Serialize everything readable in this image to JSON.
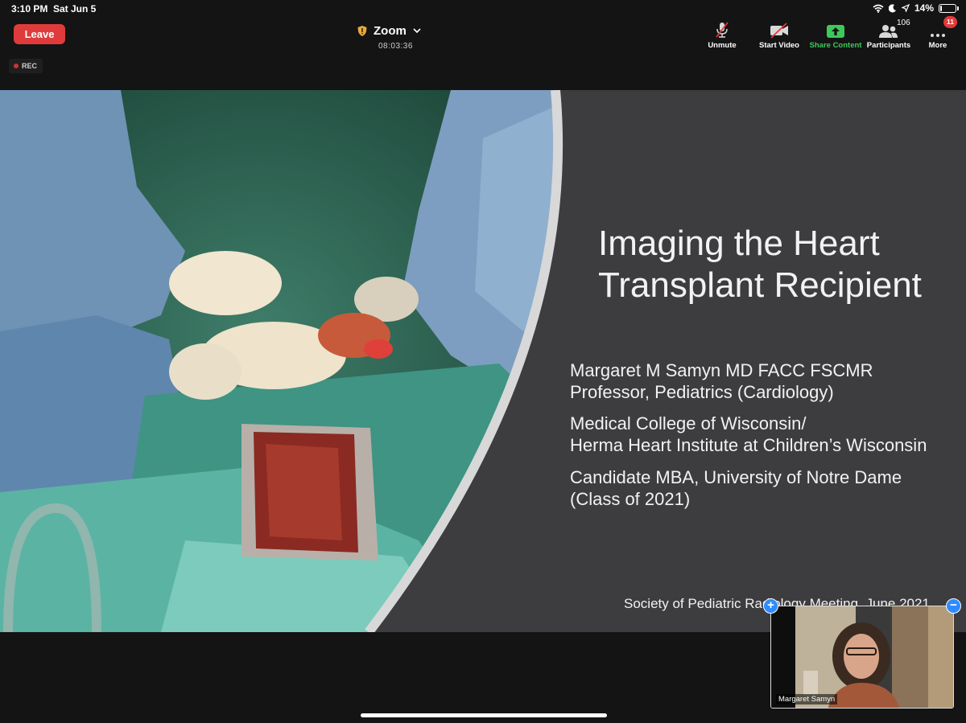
{
  "status_bar": {
    "time": "3:10 PM",
    "date": "Sat Jun 5",
    "battery": "14%",
    "battery_level": 0.14
  },
  "toolbar": {
    "leave_label": "Leave",
    "meeting_title": "Zoom",
    "timer": "08:03:36",
    "buttons": {
      "unmute": "Unmute",
      "start_video": "Start Video",
      "share_content": "Share Content",
      "participants": "Participants",
      "more": "More"
    },
    "participants_count": "106",
    "more_badge": "11",
    "share_color": "#3ec95b"
  },
  "recording": {
    "label": "REC"
  },
  "slide": {
    "title_lines": [
      "Imaging the Heart",
      "Transplant Recipient"
    ],
    "author_lines": [
      "Margaret M Samyn MD FACC FSCMR",
      "Professor, Pediatrics (Cardiology)",
      "Medical College of Wisconsin/",
      "Herma Heart Institute at Children’s Wisconsin",
      "Candidate MBA, University of Notre Dame",
      "(Class of 2021)"
    ],
    "footer": "Society of Pediatric Radiology Meeting, June 2021",
    "image_subject": "surgeons holding a donor heart above open chest"
  },
  "video_tile": {
    "participant_name": "Margaret Samyn",
    "expand_symbol": "+",
    "collapse_symbol": "−"
  }
}
